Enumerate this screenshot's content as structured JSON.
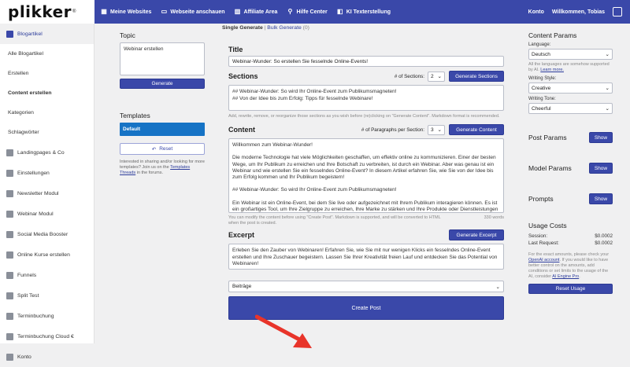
{
  "logo": {
    "text": "plikker",
    "reg": "®"
  },
  "topbar": {
    "items": [
      {
        "icon": "dashboard-icon",
        "label": "Meine Websites"
      },
      {
        "icon": "monitor-icon",
        "label": "Webseite anschauen"
      },
      {
        "icon": "chart-icon",
        "label": "Affiliate Area"
      },
      {
        "icon": "search-icon",
        "label": "Hilfe Center"
      },
      {
        "icon": "ai-icon",
        "label": "KI Texterstellung"
      }
    ],
    "account": "Konto",
    "welcome": "Willkommen, Tobias"
  },
  "sidebar": {
    "items": [
      {
        "label": "Blogartikel",
        "icon": "edit-icon",
        "active": true
      },
      {
        "label": "Alle Blogartikel",
        "sub": true
      },
      {
        "label": "Erstellen",
        "sub": true
      },
      {
        "label": "Content erstellen",
        "sub": true,
        "bold": true
      },
      {
        "label": "Kategorien",
        "sub": true
      },
      {
        "label": "Schlagwörter",
        "sub": true
      },
      {
        "label": "Landingpages & Co",
        "icon": "pages-icon"
      },
      {
        "label": "Einstellungen",
        "icon": "settings-icon"
      },
      {
        "label": "Newsletter Modul",
        "icon": "newsletter-icon"
      },
      {
        "label": "Webinar Modul",
        "icon": "video-icon"
      },
      {
        "label": "Social Media Booster",
        "icon": "share-icon"
      },
      {
        "label": "Online Kurse erstellen",
        "icon": "course-icon"
      },
      {
        "label": "Funnels",
        "icon": "funnel-icon"
      },
      {
        "label": "Split Test",
        "icon": "split-icon"
      },
      {
        "label": "Terminbuchung",
        "icon": "calendar-icon"
      },
      {
        "label": "Terminbuchung Cloud €",
        "icon": "calendar-cloud-icon"
      },
      {
        "label": "Konto",
        "icon": "account-icon"
      }
    ]
  },
  "topic": {
    "heading": "Topic",
    "value": "Webinar erstellen",
    "generate": "Generate"
  },
  "templates": {
    "heading": "Templates",
    "default": "Default",
    "reset": "Reset",
    "note_pre": "Interested in sharing and/or looking for more templates? Join us on the ",
    "note_link": "Templates Threads",
    "note_post": " in the forums."
  },
  "tabs": {
    "single": "Single Generate",
    "sep": " | ",
    "bulk": "Bulk Generate",
    "bulk_count": " (0)"
  },
  "title": {
    "label": "Title",
    "value": "Webinar-Wunder: So erstellen Sie fesselnde Online-Events!"
  },
  "sections": {
    "label": "Sections",
    "count_label": "# of Sections:",
    "count": "2",
    "button": "Generate Sections",
    "lines": [
      "## Webinar-Wunder: So wird Ihr Online-Event zum Publikumsmagneten!",
      "## Von der Idee bis zum Erfolg: Tipps für fesselnde Webinare!"
    ],
    "hint": "Add, rewrite, remove, or reorganize those sections as you wish before (re)clicking on \"Generate Content\". Markdown format is recommended."
  },
  "content": {
    "label": "Content",
    "count_label": "# of Paragraphs per Section:",
    "count": "3",
    "button": "Generate Content",
    "paragraphs": [
      "Willkommen zum Webinar-Wunder!",
      "Die moderne Technologie hat viele Möglichkeiten geschaffen, um effektiv online zu kommunizieren. Einer der besten Wege, um Ihr Publikum zu erreichen und Ihre Botschaft zu verbreiten, ist durch ein Webinar. Aber was genau ist ein Webinar und wie erstellen Sie ein fesselndes Online-Event? In diesem Artikel erfahren Sie, wie Sie von der Idee bis zum Erfolg kommen und Ihr Publikum begeistern!",
      "## Webinar-Wunder: So wird Ihr Online-Event zum Publikumsmagneten!",
      "Ein Webinar ist ein Online-Event, bei dem Sie live oder aufgezeichnet mit Ihrem Publikum interagieren können. Es ist ein großartiges Tool, um Ihre Zielgruppe zu erreichen, Ihre Marke zu stärken und Ihre Produkte oder Dienstleistungen zu bewerben. Aber wie machen Sie Ihr Webinar zu einem Publikumsmagneten?"
    ],
    "hint": "You can modify the content before using \"Create Post\". Markdown is supported, and will be converted to HTML when the post is created.",
    "words": "330 words"
  },
  "excerpt": {
    "label": "Excerpt",
    "button": "Generate Excerpt",
    "value": "Erleben Sie den Zauber von Webinaren! Erfahren Sie, wie Sie mit nur wenigen Klicks ein fesselndes Online-Event erstellen und Ihre Zuschauer begeistern. Lassen Sie Ihrer Kreativität freien Lauf und entdecken Sie das Potential von Webinaren!"
  },
  "post_type": "Beiträge",
  "create_post": "Create Post",
  "content_params": {
    "heading": "Content Params",
    "language_label": "Language:",
    "language": "Deutsch",
    "language_note_pre": "All the languages are somehow supported by AI. ",
    "language_note_link": "Learn more.",
    "style_label": "Writing Style:",
    "style": "Creative",
    "tone_label": "Writing Tone:",
    "tone": "Cheerful"
  },
  "post_params": {
    "heading": "Post Params",
    "button": "Show"
  },
  "model_params": {
    "heading": "Model Params",
    "button": "Show"
  },
  "prompts": {
    "heading": "Prompts",
    "button": "Show"
  },
  "usage": {
    "heading": "Usage Costs",
    "session_label": "Session:",
    "session": "$0.0002",
    "last_label": "Last Request:",
    "last": "$0.0002",
    "note_pre": "For the exact amounts, please check your ",
    "note_link1": "OpenAI account",
    "note_mid": ". If you would like to have better control on the amounts, add conditions or set limits to the usage of the AI, consider ",
    "note_link2": "AI Engine Pro",
    "note_post": ".",
    "reset": "Reset Usage"
  },
  "colors": {
    "accent": "#3a48a9",
    "template_active": "#1673c5",
    "arrow": "#e8342a"
  }
}
